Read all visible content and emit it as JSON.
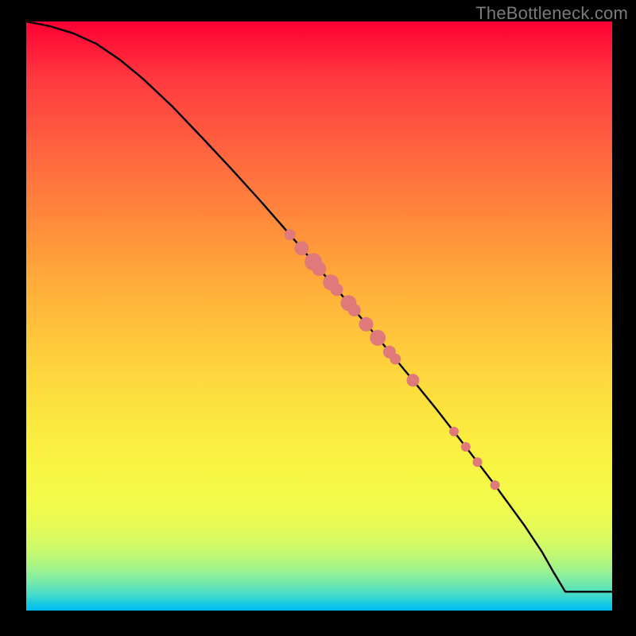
{
  "watermark": "TheBottleneck.com",
  "chart_data": {
    "type": "line",
    "title": "",
    "xlabel": "",
    "ylabel": "",
    "xlim": [
      0,
      100
    ],
    "ylim": [
      0,
      100
    ],
    "curve": {
      "x": [
        0,
        4,
        8,
        12,
        16,
        20,
        25,
        30,
        35,
        40,
        45,
        50,
        55,
        60,
        65,
        70,
        75,
        80,
        85,
        88,
        90,
        92,
        100
      ],
      "y": [
        100,
        99.2,
        98.0,
        96.2,
        93.5,
        90.2,
        85.5,
        80.3,
        75.0,
        69.5,
        63.8,
        58.0,
        52.2,
        46.3,
        40.3,
        34.2,
        27.8,
        21.3,
        14.5,
        10.0,
        6.5,
        3.2,
        3.2
      ]
    },
    "scatter": {
      "x": [
        45,
        47,
        49,
        50,
        52,
        53,
        55,
        56,
        58,
        60,
        62,
        63,
        66,
        73,
        75,
        77,
        80
      ],
      "y": [
        63.8,
        61.5,
        59.2,
        58.0,
        55.7,
        54.5,
        52.2,
        51.0,
        48.6,
        46.3,
        43.9,
        42.7,
        39.1,
        30.4,
        27.8,
        25.2,
        21.3
      ],
      "sizes": [
        7,
        9,
        11,
        9,
        10,
        8,
        10,
        8,
        9,
        10,
        8,
        7,
        8,
        6,
        6,
        6,
        6
      ]
    }
  }
}
